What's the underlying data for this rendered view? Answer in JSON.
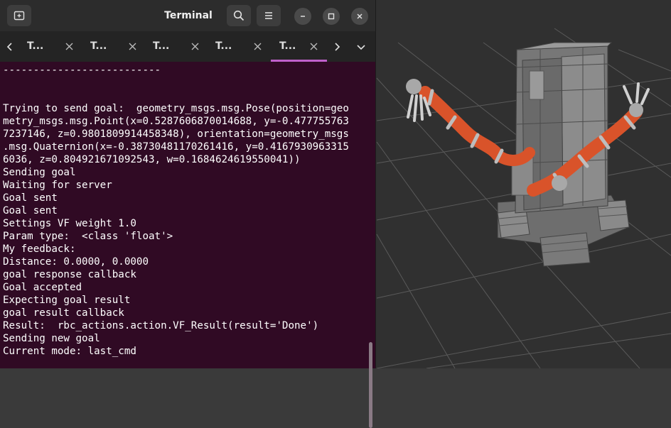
{
  "window": {
    "title": "Terminal"
  },
  "tabs": [
    {
      "label": "T...",
      "active": false
    },
    {
      "label": "T...",
      "active": false
    },
    {
      "label": "T...",
      "active": false
    },
    {
      "label": "T...",
      "active": false
    },
    {
      "label": "T...",
      "active": true
    }
  ],
  "terminal": {
    "lines": [
      "--------------------------",
      "",
      "",
      "Trying to send goal:  geometry_msgs.msg.Pose(position=geo",
      "metry_msgs.msg.Point(x=0.5287606870014688, y=-0.477755763",
      "7237146, z=0.9801809914458348), orientation=geometry_msgs",
      ".msg.Quaternion(x=-0.38730481170261416, y=0.4167930963315",
      "6036, z=0.804921671092543, w=0.1684624619550041))",
      "Sending goal",
      "Waiting for server",
      "Goal sent",
      "Goal sent",
      "Settings VF weight 1.0",
      "Param type:  <class 'float'>",
      "My feedback:",
      "Distance: 0.0000, 0.0000",
      "goal response callback",
      "Goal accepted",
      "Expecting goal result",
      "goal result callback",
      "Result:  rbc_actions.action.VF_Result(result='Done')",
      "Sending new goal",
      "Current mode: last_cmd"
    ]
  },
  "colors": {
    "terminal_bg": "#300a24",
    "headerbar_bg": "#2c2c2c",
    "tab_accent": "#c061cb",
    "viewport_bg": "#303030",
    "arm_orange": "#e0552a"
  }
}
